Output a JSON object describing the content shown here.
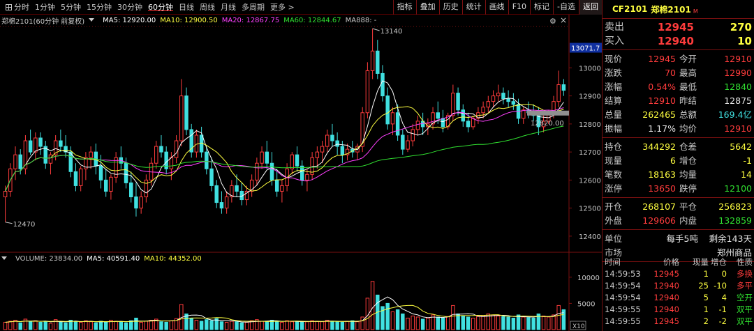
{
  "toolbar": {
    "periods": [
      "分时",
      "1分钟",
      "5分钟",
      "15分钟",
      "30分钟",
      "60分钟",
      "日线",
      "周线",
      "月线",
      "多周期",
      "更多 >"
    ],
    "active_period": 5,
    "buttons": [
      "指标",
      "叠加",
      "历史",
      "统计",
      "画线",
      "F10",
      "标记",
      "-自选",
      "返回"
    ]
  },
  "price_legend": {
    "title": "郑棉2101(60分钟 前复权)",
    "ma5": "MA5: 12920.00",
    "ma10": "MA10: 12900.50",
    "ma20": "MA20: 12867.75",
    "ma60": "MA60: 12844.67",
    "ma888": "MA888: -"
  },
  "volume_legend": {
    "volume": "VOLUME: 23834.00",
    "ma5": "MA5: 40591.40",
    "ma10": "MA10: 44352.00"
  },
  "colors": {
    "up": "#ff3c3c",
    "down": "#40e0e0",
    "ma5": "#ffffff",
    "ma10": "#ffff40",
    "ma20": "#ff40ff",
    "ma60": "#30e030",
    "grid": "#7a1010"
  },
  "chart_data": {
    "type": "candlestick",
    "price_axis": {
      "ticks": [
        12400,
        12500,
        12600,
        12700,
        12800,
        12900,
        13000
      ],
      "labels": [
        "12400",
        "12500",
        "12600",
        "12700",
        "12800",
        "12900",
        "13000"
      ],
      "ylim": [
        12350,
        13150
      ]
    },
    "volume_axis": {
      "ticks": [
        5000,
        10000
      ],
      "labels": [
        "5000",
        "10000"
      ],
      "ylim": [
        0,
        12500
      ],
      "multiplier_label": "X10"
    },
    "annotations": {
      "high": "13140",
      "low": "12470",
      "last": "12820.00",
      "current_label": "13071.7"
    },
    "candles": [
      [
        12540,
        12580,
        12450,
        12560
      ],
      [
        12560,
        12660,
        12540,
        12640
      ],
      [
        12640,
        12720,
        12600,
        12690
      ],
      [
        12690,
        12710,
        12620,
        12640
      ],
      [
        12640,
        12760,
        12620,
        12740
      ],
      [
        12740,
        12780,
        12690,
        12700
      ],
      [
        12700,
        12770,
        12670,
        12750
      ],
      [
        12750,
        12770,
        12690,
        12720
      ],
      [
        12720,
        12740,
        12640,
        12660
      ],
      [
        12660,
        12700,
        12620,
        12690
      ],
      [
        12690,
        12760,
        12670,
        12740
      ],
      [
        12740,
        12780,
        12700,
        12720
      ],
      [
        12720,
        12760,
        12680,
        12700
      ],
      [
        12700,
        12720,
        12610,
        12630
      ],
      [
        12630,
        12660,
        12560,
        12580
      ],
      [
        12580,
        12650,
        12560,
        12640
      ],
      [
        12640,
        12700,
        12600,
        12680
      ],
      [
        12680,
        12720,
        12640,
        12700
      ],
      [
        12700,
        12730,
        12620,
        12650
      ],
      [
        12650,
        12690,
        12570,
        12600
      ],
      [
        12600,
        12640,
        12540,
        12560
      ],
      [
        12560,
        12620,
        12530,
        12610
      ],
      [
        12610,
        12700,
        12590,
        12680
      ],
      [
        12680,
        12720,
        12640,
        12660
      ],
      [
        12660,
        12680,
        12570,
        12590
      ],
      [
        12590,
        12630,
        12520,
        12540
      ],
      [
        12540,
        12590,
        12470,
        12500
      ],
      [
        12500,
        12560,
        12480,
        12540
      ],
      [
        12540,
        12620,
        12520,
        12600
      ],
      [
        12600,
        12680,
        12580,
        12660
      ],
      [
        12660,
        12740,
        12640,
        12720
      ],
      [
        12720,
        12760,
        12680,
        12700
      ],
      [
        12700,
        12720,
        12620,
        12640
      ],
      [
        12640,
        12700,
        12600,
        12680
      ],
      [
        12680,
        12760,
        12660,
        12740
      ],
      [
        12740,
        12960,
        12720,
        12900
      ],
      [
        12900,
        12930,
        12760,
        12780
      ],
      [
        12780,
        12800,
        12680,
        12700
      ],
      [
        12700,
        12780,
        12680,
        12760
      ],
      [
        12760,
        12790,
        12680,
        12700
      ],
      [
        12700,
        12720,
        12620,
        12640
      ],
      [
        12640,
        12680,
        12560,
        12580
      ],
      [
        12580,
        12600,
        12500,
        12520
      ],
      [
        12520,
        12560,
        12480,
        12500
      ],
      [
        12500,
        12560,
        12480,
        12540
      ],
      [
        12540,
        12600,
        12520,
        12580
      ],
      [
        12580,
        12620,
        12540,
        12560
      ],
      [
        12560,
        12590,
        12510,
        12530
      ],
      [
        12530,
        12580,
        12510,
        12560
      ],
      [
        12560,
        12620,
        12540,
        12600
      ],
      [
        12600,
        12680,
        12580,
        12660
      ],
      [
        12660,
        12720,
        12640,
        12700
      ],
      [
        12700,
        12740,
        12640,
        12660
      ],
      [
        12660,
        12700,
        12580,
        12600
      ],
      [
        12600,
        12640,
        12540,
        12560
      ],
      [
        12560,
        12600,
        12520,
        12580
      ],
      [
        12580,
        12660,
        12560,
        12640
      ],
      [
        12640,
        12700,
        12620,
        12690
      ],
      [
        12690,
        12720,
        12630,
        12650
      ],
      [
        12650,
        12670,
        12580,
        12600
      ],
      [
        12600,
        12640,
        12560,
        12620
      ],
      [
        12620,
        12700,
        12600,
        12680
      ],
      [
        12680,
        12720,
        12640,
        12700
      ],
      [
        12700,
        12740,
        12660,
        12720
      ],
      [
        12720,
        12780,
        12700,
        12760
      ],
      [
        12760,
        12800,
        12720,
        12740
      ],
      [
        12740,
        12770,
        12690,
        12720
      ],
      [
        12720,
        12740,
        12660,
        12690
      ],
      [
        12690,
        12730,
        12670,
        12710
      ],
      [
        12710,
        12740,
        12680,
        12700
      ],
      [
        12700,
        12730,
        12670,
        12720
      ],
      [
        12720,
        12860,
        12700,
        12840
      ],
      [
        12840,
        13020,
        12820,
        12990
      ],
      [
        12990,
        13140,
        12960,
        13060
      ],
      [
        13060,
        13100,
        12960,
        12980
      ],
      [
        12980,
        13010,
        12880,
        12900
      ],
      [
        12900,
        12930,
        12780,
        12800
      ],
      [
        12800,
        12860,
        12760,
        12840
      ],
      [
        12840,
        12870,
        12740,
        12760
      ],
      [
        12760,
        12780,
        12690,
        12710
      ],
      [
        12710,
        12760,
        12700,
        12740
      ],
      [
        12740,
        12800,
        12720,
        12780
      ],
      [
        12780,
        12830,
        12760,
        12810
      ],
      [
        12810,
        12840,
        12760,
        12790
      ],
      [
        12790,
        12820,
        12760,
        12800
      ],
      [
        12800,
        12860,
        12780,
        12840
      ],
      [
        12840,
        12880,
        12800,
        12820
      ],
      [
        12820,
        12850,
        12770,
        12790
      ],
      [
        12790,
        12840,
        12780,
        12830
      ],
      [
        12830,
        12940,
        12810,
        12910
      ],
      [
        12910,
        12930,
        12830,
        12850
      ],
      [
        12850,
        12870,
        12790,
        12810
      ],
      [
        12810,
        12840,
        12770,
        12790
      ],
      [
        12790,
        12830,
        12780,
        12820
      ],
      [
        12820,
        12860,
        12800,
        12840
      ],
      [
        12840,
        12880,
        12820,
        12860
      ],
      [
        12860,
        12900,
        12840,
        12880
      ],
      [
        12880,
        12920,
        12860,
        12900
      ],
      [
        12900,
        12940,
        12880,
        12910
      ],
      [
        12910,
        12930,
        12870,
        12890
      ],
      [
        12890,
        12920,
        12860,
        12880
      ],
      [
        12880,
        12910,
        12850,
        12870
      ],
      [
        12870,
        12890,
        12800,
        12820
      ],
      [
        12820,
        12860,
        12800,
        12850
      ],
      [
        12850,
        12880,
        12820,
        12840
      ],
      [
        12840,
        12870,
        12810,
        12830
      ],
      [
        12830,
        12860,
        12760,
        12790
      ],
      [
        12790,
        12830,
        12770,
        12810
      ],
      [
        12810,
        12850,
        12800,
        12840
      ],
      [
        12840,
        12900,
        12820,
        12880
      ],
      [
        12880,
        12990,
        12860,
        12940
      ],
      [
        12940,
        12960,
        12900,
        12920
      ]
    ],
    "volumes": [
      14,
      16,
      18,
      13,
      20,
      15,
      17,
      14,
      16,
      12,
      19,
      15,
      13,
      18,
      16,
      14,
      17,
      15,
      13,
      16,
      14,
      18,
      16,
      15,
      13,
      17,
      22,
      14,
      16,
      18,
      20,
      15,
      14,
      17,
      21,
      48,
      30,
      22,
      18,
      16,
      19,
      17,
      21,
      15,
      14,
      16,
      15,
      13,
      14,
      17,
      19,
      16,
      15,
      18,
      16,
      14,
      17,
      15,
      16,
      14,
      15,
      17,
      16,
      15,
      18,
      16,
      15,
      14,
      16,
      17,
      15,
      24,
      60,
      92,
      66,
      44,
      50,
      34,
      38,
      30,
      22,
      26,
      24,
      20,
      22,
      28,
      24,
      22,
      25,
      46,
      30,
      26,
      24,
      22,
      25,
      27,
      30,
      28,
      26,
      25,
      24,
      22,
      28,
      24,
      23,
      22,
      30,
      26,
      24,
      28,
      46,
      38
    ]
  },
  "quote": {
    "symbol_code": "CF2101",
    "symbol_name": "郑棉2101",
    "market_badge": "M",
    "sell_label": "卖出",
    "sell_price": "12945",
    "sell_qty": "270",
    "buy_label": "买入",
    "buy_price": "12940",
    "buy_qty": "10",
    "rows": [
      [
        "现价",
        "12945",
        "今开",
        "12910"
      ],
      [
        "涨跌",
        "70",
        "最高",
        "12990"
      ],
      [
        "涨幅",
        "0.54%",
        "最低",
        "12840"
      ],
      [
        "结算",
        "12910",
        "昨结",
        "12875"
      ],
      [
        "总量",
        "262465",
        "总额",
        "169.4亿"
      ],
      [
        "振幅",
        "1.17%",
        "均价",
        "12910"
      ]
    ],
    "rows2": [
      [
        "持仓",
        "344292",
        "仓差",
        "5642"
      ],
      [
        "现量",
        "6",
        "增仓",
        "-1"
      ],
      [
        "笔数",
        "18163",
        "均量",
        "14"
      ],
      [
        "涨停",
        "13650",
        "跌停",
        "12100"
      ]
    ],
    "rows3": [
      [
        "开仓",
        "268107",
        "平仓",
        "256823"
      ],
      [
        "外盘",
        "129606",
        "内盘",
        "132859"
      ]
    ],
    "rows4": [
      [
        "单位",
        "",
        "每手5吨",
        "剩余143天"
      ],
      [
        "市场",
        "",
        "",
        "郑州商品"
      ]
    ]
  },
  "trades": {
    "headers": [
      "时间",
      "价格",
      "现量",
      "增仓",
      "性质"
    ],
    "rows": [
      [
        "14:59:53",
        "12945",
        "1",
        "0",
        "多换"
      ],
      [
        "14:59:54",
        "12940",
        "25",
        "-10",
        "多平"
      ],
      [
        "14:59:54",
        "12940",
        "5",
        "4",
        "空开"
      ],
      [
        "14:59:55",
        "12940",
        "1",
        "-1",
        "双平"
      ],
      [
        "14:59:55",
        "12945",
        "2",
        "-2",
        "双平"
      ]
    ]
  }
}
